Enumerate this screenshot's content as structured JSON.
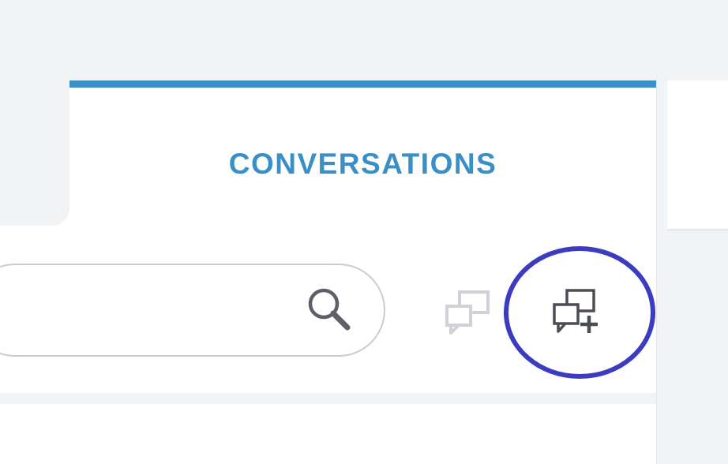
{
  "tabs": {
    "active_label": "CONVERSATIONS",
    "accent_color": "#3a8fc7"
  },
  "search": {
    "placeholder": "",
    "icon": "search-icon"
  },
  "actions": {
    "conversations_icon": "conversations-icon",
    "new_conversation_icon": "new-conversation-icon",
    "highlight_color": "#3b3cc0"
  }
}
